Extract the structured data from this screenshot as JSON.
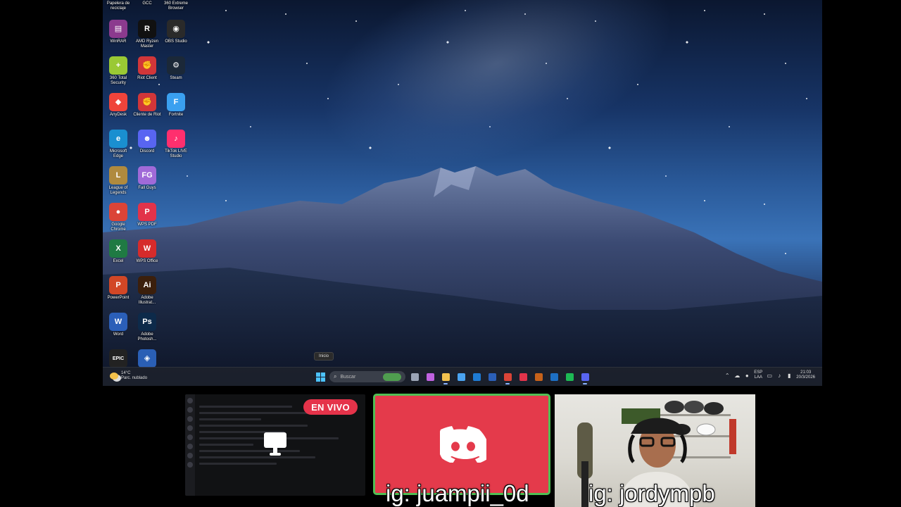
{
  "desktop": {
    "tooltip": "Inicio",
    "icons": [
      {
        "label": "Papelera de reciclaje",
        "icon": "recycle-bin-icon",
        "color": "#6f8fb7",
        "glyph": "",
        "top": true
      },
      {
        "label": "GCC",
        "icon": "gcc-icon",
        "color": "#555555",
        "glyph": "",
        "top": true
      },
      {
        "label": "360 Extreme Browser",
        "icon": "browser-icon",
        "color": "#4a7fd1",
        "glyph": "",
        "top": true
      },
      {
        "label": "WinRAR",
        "icon": "winrar-icon",
        "color": "#8b3a8e",
        "glyph": "▤"
      },
      {
        "label": "AMD Ryzen Master",
        "icon": "amd-ryzen-icon",
        "color": "#111111",
        "glyph": "R"
      },
      {
        "label": "OBS Studio",
        "icon": "obs-icon",
        "color": "#2a2a2a",
        "glyph": "◉"
      },
      {
        "label": "360 Total Security",
        "icon": "security-icon",
        "color": "#9ac934",
        "glyph": "+"
      },
      {
        "label": "Riot Client",
        "icon": "riot-icon",
        "color": "#d13639",
        "glyph": "✊"
      },
      {
        "label": "Steam",
        "icon": "steam-icon",
        "color": "#1b2838",
        "glyph": "⚙"
      },
      {
        "label": "AnyDesk",
        "icon": "anydesk-icon",
        "color": "#ef443b",
        "glyph": "◆"
      },
      {
        "label": "Cliente de Riot",
        "icon": "riot-client-icon",
        "color": "#d13639",
        "glyph": "✊"
      },
      {
        "label": "Fortnite",
        "icon": "fortnite-icon",
        "color": "#3aa0f0",
        "glyph": "F"
      },
      {
        "label": "Microsoft Edge",
        "icon": "edge-icon",
        "color": "#1a8fd0",
        "glyph": "e"
      },
      {
        "label": "Discord",
        "icon": "discord-icon",
        "color": "#5865f2",
        "glyph": "☻"
      },
      {
        "label": "TikTok LIVE Studio",
        "icon": "tiktok-icon",
        "color": "#ff2f6e",
        "glyph": "♪"
      },
      {
        "label": "League of Legends",
        "icon": "lol-icon",
        "color": "#b08a3e",
        "glyph": "L"
      },
      {
        "label": "Fall Guys",
        "icon": "fall-guys-icon",
        "color": "#a06ad8",
        "glyph": "FG"
      },
      {
        "label": "",
        "icon": "blank-icon",
        "color": "transparent",
        "glyph": ""
      },
      {
        "label": "Google Chrome",
        "icon": "chrome-icon",
        "color": "#db4437",
        "glyph": "●"
      },
      {
        "label": "WPS PDF",
        "icon": "wps-pdf-icon",
        "color": "#e2334a",
        "glyph": "P"
      },
      {
        "label": "",
        "icon": "blank-icon",
        "color": "transparent",
        "glyph": ""
      },
      {
        "label": "Excel",
        "icon": "excel-icon",
        "color": "#1f7a43",
        "glyph": "X"
      },
      {
        "label": "WPS Office",
        "icon": "wps-office-icon",
        "color": "#d62b2b",
        "glyph": "W"
      },
      {
        "label": "",
        "icon": "blank-icon",
        "color": "transparent",
        "glyph": ""
      },
      {
        "label": "PowerPoint",
        "icon": "powerpoint-icon",
        "color": "#d24726",
        "glyph": "P"
      },
      {
        "label": "Adobe Illustrat...",
        "icon": "illustrator-icon",
        "color": "#3b1f0c",
        "glyph": "Ai"
      },
      {
        "label": "",
        "icon": "blank-icon",
        "color": "transparent",
        "glyph": ""
      },
      {
        "label": "Word",
        "icon": "word-icon",
        "color": "#2b5fb8",
        "glyph": "W"
      },
      {
        "label": "Adobe Photosh...",
        "icon": "photoshop-icon",
        "color": "#0d2a4a",
        "glyph": "Ps"
      },
      {
        "label": "",
        "icon": "blank-icon",
        "color": "transparent",
        "glyph": ""
      },
      {
        "label": "",
        "icon": "epic-games-icon",
        "color": "#222222",
        "glyph": "EPIC"
      },
      {
        "label": "",
        "icon": "rocket-league-icon",
        "color": "#2a5fb5",
        "glyph": "◈"
      }
    ]
  },
  "taskbar": {
    "weather_temp": "14°C",
    "weather_desc": "Parc. nublado",
    "search_placeholder": "Buscar",
    "apps": [
      {
        "name": "task-view-icon",
        "color": "#9aa3b5",
        "active": false
      },
      {
        "name": "copilot-icon",
        "color": "#c062e0",
        "active": false
      },
      {
        "name": "file-explorer-icon",
        "color": "#f2c14e",
        "active": true
      },
      {
        "name": "store-icon",
        "color": "#4aa3f0",
        "active": false
      },
      {
        "name": "outlook-icon",
        "color": "#1e7bd4",
        "active": false
      },
      {
        "name": "word-icon",
        "color": "#2b5fb8",
        "active": false
      },
      {
        "name": "chrome-icon",
        "color": "#db4437",
        "active": true
      },
      {
        "name": "wps-icon",
        "color": "#e2334a",
        "active": false
      },
      {
        "name": "illustrator-icon",
        "color": "#c7621a",
        "active": false
      },
      {
        "name": "photoshop-icon",
        "color": "#1d6fc4",
        "active": false
      },
      {
        "name": "spotify-icon",
        "color": "#1db954",
        "active": false
      },
      {
        "name": "discord-icon",
        "color": "#5865f2",
        "active": true
      }
    ],
    "lang_top": "ESP",
    "lang_bottom": "LAA",
    "time": "21:03",
    "date": "20/3/2026"
  },
  "stream": {
    "live_badge": "EN VIVO",
    "caption_discord": "ig: juampii_0d",
    "caption_cam": "ig: jordympb",
    "colors": {
      "discord_panel": "#e43a4b",
      "discord_border": "#4fbf54",
      "live_badge": "#e5334a"
    }
  }
}
